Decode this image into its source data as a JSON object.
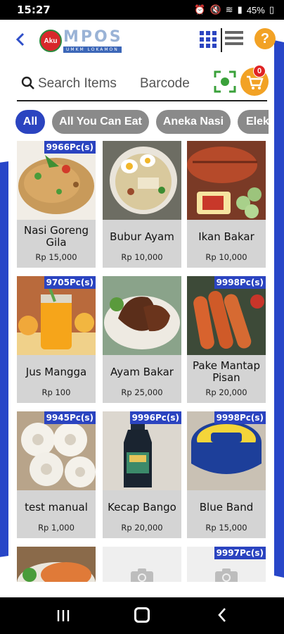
{
  "status_bar": {
    "time": "15:27",
    "battery": "45%"
  },
  "header": {
    "logo_badge": "Aku",
    "logo_word": "MPOS",
    "logo_sub": "UMKM LOKAMON"
  },
  "search": {
    "placeholder": "Search Items",
    "barcode_label": "Barcode",
    "cart_count": "0"
  },
  "categories": [
    "All",
    "All You Can Eat",
    "Aneka Nasi",
    "Elek"
  ],
  "colors": {
    "accent": "#2b44c0",
    "cart": "#f2a225",
    "badge": "#e02424",
    "chip": "#8a8a8a"
  },
  "products": [
    {
      "name": "Nasi Goreng Gila",
      "price": "Rp 15,000",
      "stock": "9966Pc(s)",
      "icon": "fried-rice"
    },
    {
      "name": "Bubur Ayam",
      "price": "Rp 10,000",
      "stock": "",
      "icon": "rice-porridge"
    },
    {
      "name": "Ikan Bakar",
      "price": "Rp 10,000",
      "stock": "",
      "icon": "grilled-fish"
    },
    {
      "name": "Jus Mangga",
      "price": "Rp 100",
      "stock": "9705Pc(s)",
      "icon": "mango-juice"
    },
    {
      "name": "Ayam Bakar",
      "price": "Rp 25,000",
      "stock": "",
      "icon": "grilled-chicken"
    },
    {
      "name": "Pake Mantap Pisan",
      "price": "Rp 20,000",
      "stock": "9998Pc(s)",
      "icon": "sausages"
    },
    {
      "name": "test manual",
      "price": "Rp 1,000",
      "stock": "9945Pc(s)",
      "icon": "crackers"
    },
    {
      "name": "Kecap Bango",
      "price": "Rp 20,000",
      "stock": "9996Pc(s)",
      "icon": "soy-sauce-bottle"
    },
    {
      "name": "Blue Band",
      "price": "Rp 15,000",
      "stock": "9998Pc(s)",
      "icon": "margarine-tub"
    },
    {
      "name": "",
      "price": "",
      "stock": "",
      "icon": "food-plate"
    },
    {
      "name": "",
      "price": "",
      "stock": "",
      "icon": "camera-placeholder"
    },
    {
      "name": "",
      "price": "",
      "stock": "9997Pc(s)",
      "icon": "camera-placeholder"
    }
  ]
}
